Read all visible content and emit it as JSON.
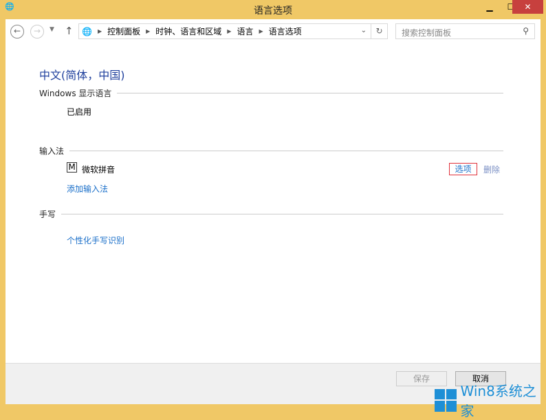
{
  "window": {
    "title": "语言选项"
  },
  "nav": {
    "breadcrumb": [
      "控制面板",
      "时钟、语言和区域",
      "语言",
      "语言选项"
    ],
    "search_placeholder": "搜索控制面板"
  },
  "main": {
    "heading": "中文(简体，中国)",
    "display_section": "Windows 显示语言",
    "display_status": "已启用",
    "ime_section": "输入法",
    "ime_icon_letter": "M",
    "ime_name": "微软拼音",
    "ime_options": "选项",
    "ime_remove": "删除",
    "add_ime": "添加输入法",
    "handwriting_section": "手写",
    "handwriting_link": "个性化手写识别"
  },
  "footer": {
    "save": "保存",
    "cancel": "取消"
  },
  "watermark": "Win8系统之家"
}
